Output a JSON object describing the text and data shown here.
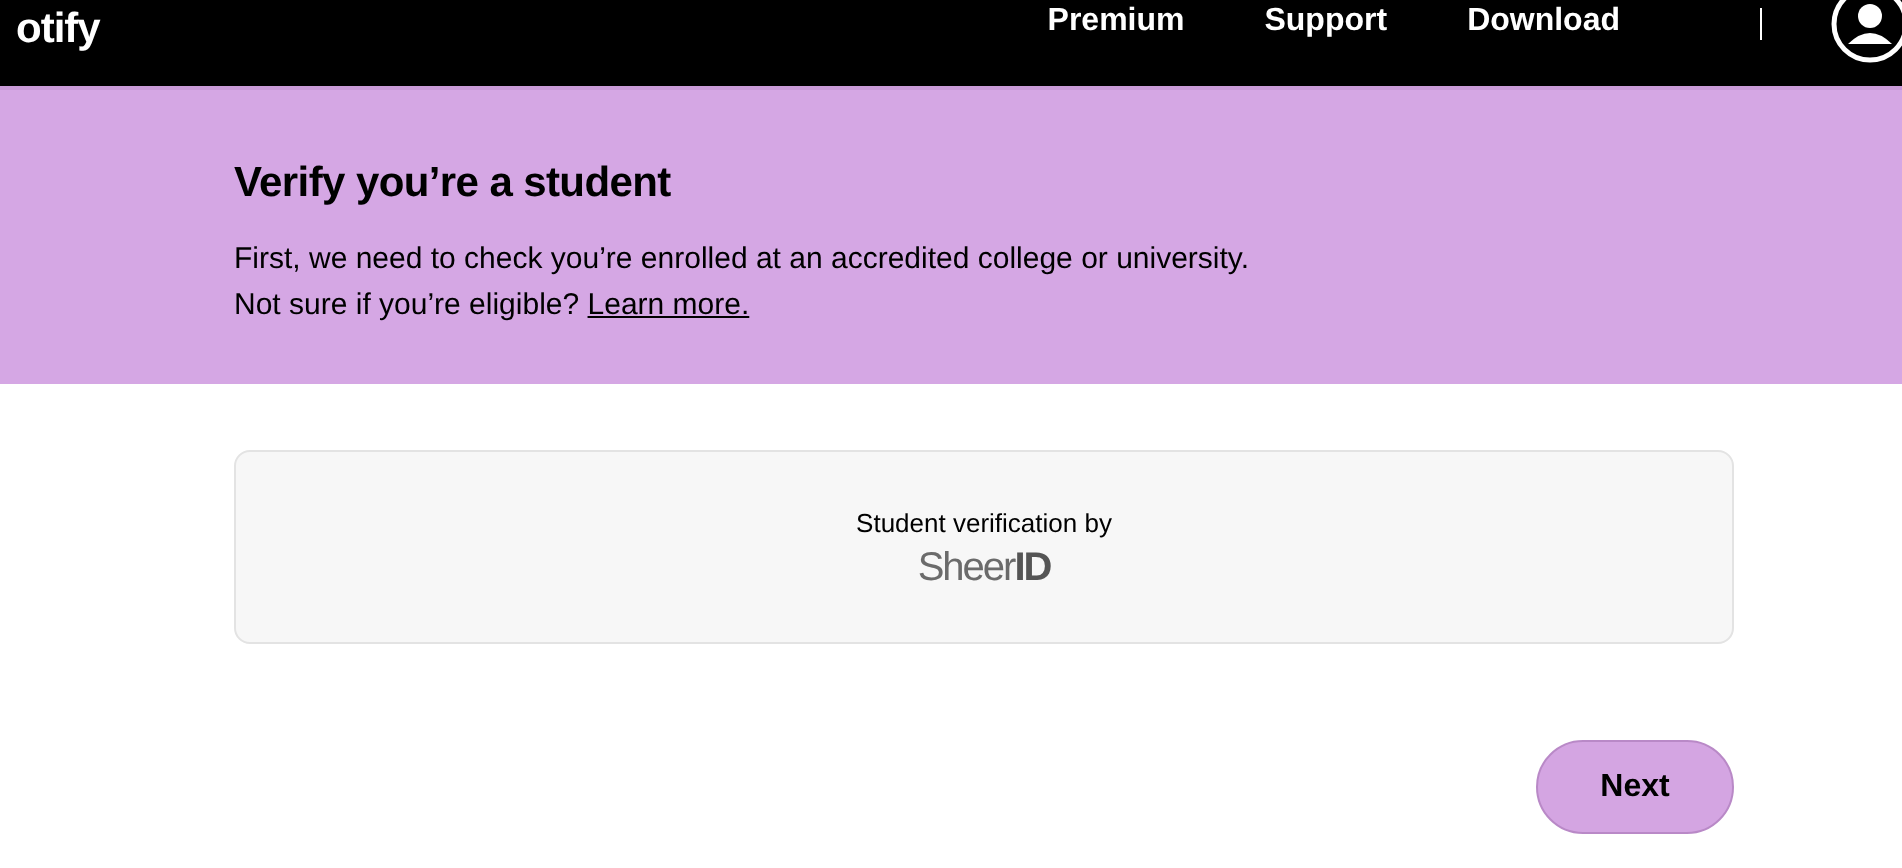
{
  "header": {
    "logo": "otify",
    "nav": [
      {
        "label": "Premium"
      },
      {
        "label": "Support"
      },
      {
        "label": "Download"
      }
    ]
  },
  "banner": {
    "title": "Verify you’re a student",
    "lines": [
      "First, we need to check you’re enrolled at an accredited college or university.",
      "Not sure if you’re eligible?"
    ],
    "link": "Learn more."
  },
  "card": {
    "caption": "Student verification by",
    "logo": "SheerID"
  },
  "buttons": [
    {
      "label": "Next"
    }
  ]
}
